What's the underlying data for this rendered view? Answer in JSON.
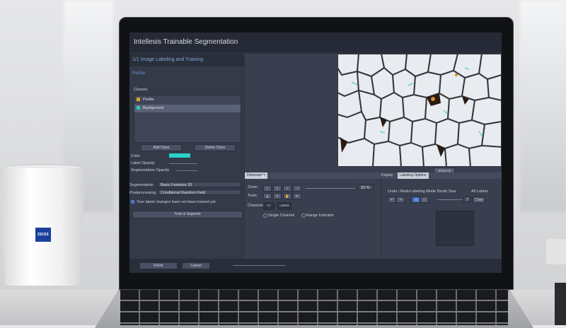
{
  "app": {
    "title": "Intellesis Trainable Segmentation"
  },
  "left": {
    "section": "1/1 Image Labeling and Training",
    "model_name": "Perlite",
    "classes_label": "Classes",
    "classes": [
      {
        "name": "Perlite",
        "color": "#e0a030"
      },
      {
        "name": "Background",
        "color": "#28c8c0"
      }
    ],
    "add_class": "Add Class",
    "delete_class": "Delete Class",
    "color_label": "Color",
    "color_value": "#28d2c8",
    "label_opacity_label": "Label Opacity",
    "seg_opacity_label": "Segmentation Opacity",
    "segmentation_label": "Segmentation",
    "segmentation_value": "Basic Features 33",
    "postprocessing_label": "Postprocessing",
    "postprocessing_value": "Conditional Random Field",
    "status_text": "Your latest changes have not been trained yet.",
    "train_button": "Train & Segment"
  },
  "viewer": {
    "show_all": "Show All"
  },
  "tabs": {
    "dimensions": "Dimensions",
    "display": "Display",
    "labeling": "Labeling Options"
  },
  "dims": {
    "zoom_label": "Zoom",
    "zoom_value": "33 %",
    "tools_label": "Tools",
    "channels_label": "Channels",
    "ch1": "C1",
    "ch2": "Labels",
    "single_channel": "Single Channel",
    "range_indicator": "Range Indicator"
  },
  "labeling": {
    "undo_redo": "Undo / Redo",
    "labeling_mode": "Labeling Mode",
    "brush_size": "Brush Size",
    "all_labels": "All Labels",
    "clear": "Clear",
    "brush_value": "7"
  },
  "footer": {
    "finish": "Finish",
    "cancel": "Cancel"
  },
  "cup": {
    "logo": "ZEISS"
  }
}
